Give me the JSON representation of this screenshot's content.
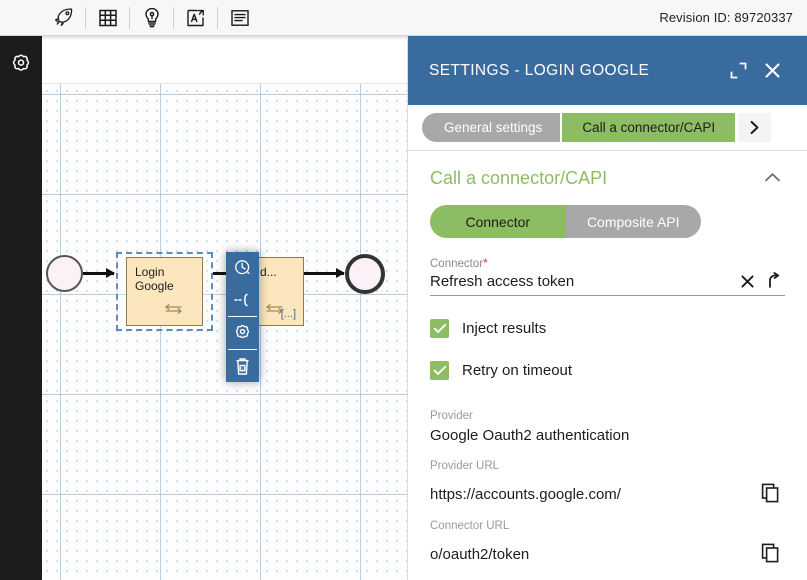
{
  "toolbar": {
    "icons": [
      {
        "name": "rocket-icon",
        "label": "Run"
      },
      {
        "name": "grid-table-icon",
        "label": "Data grid"
      },
      {
        "name": "lightbulb-icon",
        "label": "Suggestions"
      },
      {
        "name": "pdf-export-icon",
        "label": "Export PDF"
      },
      {
        "name": "document-list-icon",
        "label": "Documentation"
      }
    ],
    "revision_label": "Revision ID: 89720337"
  },
  "rail": {
    "items": [
      {
        "name": "gear-icon",
        "label": "Settings"
      }
    ]
  },
  "canvas": {
    "nodes": [
      {
        "label": "Login Google",
        "icon": "loop-icon"
      },
      {
        "label": "d...",
        "icon": "loop-icon",
        "ellipsis": "[...]"
      }
    ],
    "events": [
      {
        "name": "start-event",
        "label": ""
      },
      {
        "name": "end-event",
        "label": ""
      }
    ],
    "context_toolbar": [
      {
        "name": "clock-icon",
        "label": "Timer"
      },
      {
        "name": "boundary-event-icon",
        "label": "Boundary event"
      },
      {
        "name": "gear-icon",
        "label": "Settings"
      },
      {
        "name": "trash-icon",
        "label": "Delete"
      }
    ]
  },
  "panel": {
    "title": "SETTINGS  -  LOGIN GOOGLE",
    "expand_icon": "expand-icon",
    "close_icon": "close-icon",
    "tabs": [
      {
        "label": "General settings",
        "active": false
      },
      {
        "label": "Call a connector/CAPI",
        "active": true
      }
    ],
    "tab_next_icon": "chevron-right-icon",
    "section": {
      "title": "Call a connector/CAPI",
      "collapse_icon": "chevron-up-icon"
    },
    "segmented": {
      "options": [
        "Connector",
        "Composite API"
      ],
      "selected": "Connector"
    },
    "connector_field": {
      "label": "Connector",
      "required_marker": "*",
      "value": "Refresh access token",
      "clear_icon": "close-icon",
      "go_icon": "redo-arrow-icon"
    },
    "checkboxes": [
      {
        "label": "Inject results",
        "checked": true
      },
      {
        "label": "Retry on timeout",
        "checked": true
      }
    ],
    "readonly_fields": [
      {
        "label": "Provider",
        "value": "Google Oauth2 authentication",
        "copyable": false
      },
      {
        "label": "Provider URL",
        "value": "https://accounts.google.com/",
        "copyable": true
      },
      {
        "label": "Connector URL",
        "value": "o/oauth2/token",
        "copyable": true
      }
    ]
  },
  "colors": {
    "header_blue": "#3a6b9e",
    "accent_green": "#8dbd63",
    "inactive_gray": "#a8a8a8",
    "node_fill": "#fbe6bd",
    "required_red": "#e03a2f"
  }
}
